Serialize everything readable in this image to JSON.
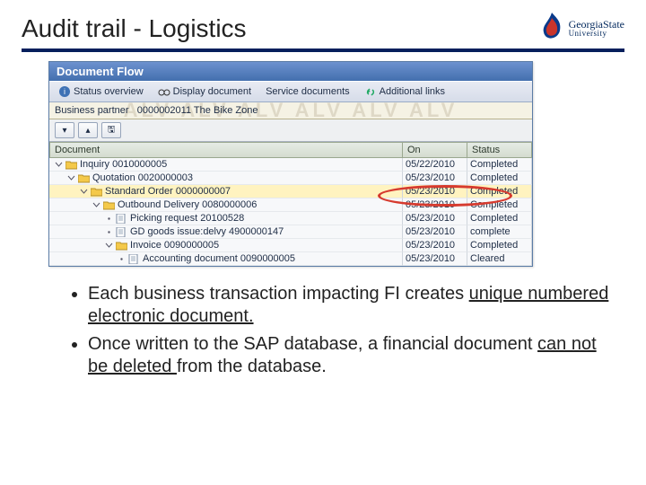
{
  "slide": {
    "title": "Audit trail - Logistics",
    "logo": {
      "name": "GeorgiaState",
      "sub": "University"
    }
  },
  "sap": {
    "window_title": "Document Flow",
    "toolbar": {
      "status_overview": "Status overview",
      "display_document": "Display document",
      "service_documents": "Service documents",
      "additional_links": "Additional links"
    },
    "partner": {
      "label": "Business partner",
      "value": "0000002011 The Bike Zone"
    },
    "watermark": "ALV ALV ALV ALV ALV ALV",
    "columns": {
      "doc": "Document",
      "on": "On",
      "status": "Status"
    },
    "rows": [
      {
        "indent": 0,
        "icon": "folder",
        "label": "Inquiry 0010000005",
        "on": "05/22/2010",
        "status": "Completed",
        "hl": false
      },
      {
        "indent": 1,
        "icon": "folder",
        "label": "Quotation 0020000003",
        "on": "05/23/2010",
        "status": "Completed",
        "hl": false
      },
      {
        "indent": 2,
        "icon": "folder",
        "label": "Standard Order 0000000007",
        "on": "05/23/2010",
        "status": "Completed",
        "hl": true
      },
      {
        "indent": 3,
        "icon": "folder",
        "label": "Outbound Delivery 0080000006",
        "on": "05/23/2010",
        "status": "Completed",
        "hl": false
      },
      {
        "indent": 4,
        "icon": "doc",
        "label": "Picking request 20100528",
        "on": "05/23/2010",
        "status": "Completed",
        "hl": false
      },
      {
        "indent": 4,
        "icon": "doc",
        "label": "GD goods issue:delvy 4900000147",
        "on": "05/23/2010",
        "status": "complete",
        "hl": false
      },
      {
        "indent": 4,
        "icon": "folder",
        "label": "Invoice 0090000005",
        "on": "05/23/2010",
        "status": "Completed",
        "hl": false
      },
      {
        "indent": 5,
        "icon": "doc",
        "label": "Accounting document 0090000005",
        "on": "05/23/2010",
        "status": "Cleared",
        "hl": false
      }
    ]
  },
  "bullets": {
    "b1a": "Each business transaction impacting FI creates ",
    "b1u": "unique numbered electronic document.",
    "b2a": "Once written to the SAP database, a financial document ",
    "b2u": "can not be deleted ",
    "b2b": "from the database."
  }
}
